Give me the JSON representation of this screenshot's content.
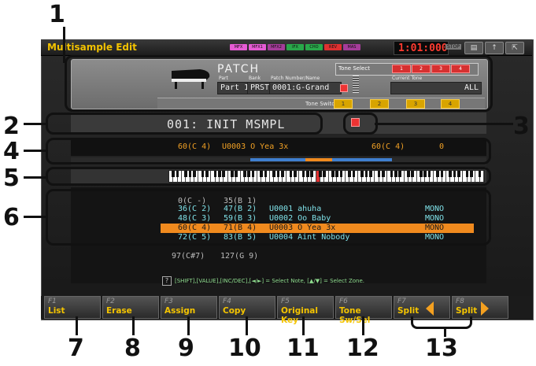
{
  "window": {
    "title": "Multisample Edit",
    "indicators": [
      "MFX",
      "MFX1",
      "MFX2",
      "IFX",
      "CHO",
      "REV",
      "MAS"
    ],
    "indicator_colors": [
      "#e65bd4",
      "#e65bd4",
      "#a53c9a",
      "#29a84a",
      "#29a84a",
      "#e03030",
      "#a53c9a"
    ],
    "clock": "1:01:000",
    "stop_label": "STOP"
  },
  "patch": {
    "header": "PATCH",
    "tone_select_label": "Tone Select",
    "tone_buttons": [
      "1",
      "2",
      "3",
      "4"
    ],
    "part_label": "Part",
    "part_value": "Part 1",
    "bank_label": "Bank",
    "bank_value": "PRST",
    "patch_number_label": "Patch Number/Name",
    "patch_number_value": "0001:G-Grand",
    "current_tone_label": "Current Tone",
    "current_tone_value": "ALL",
    "tone_switch_label": "Tone Switch",
    "tone_switches": [
      "1",
      "2",
      "3",
      "4"
    ]
  },
  "multisample": {
    "name": "001: INIT MSMPL"
  },
  "zone_info": {
    "low_key": "60(C 4)",
    "sample": "U0003 O Yea 3x",
    "high_key": "60(C 4)",
    "value": "0"
  },
  "zone_list": {
    "top_row": {
      "low": "0(C -)",
      "high": "35(B 1)"
    },
    "rows": [
      {
        "low": "36(C 2)",
        "high": "47(B 2)",
        "sample": "U0001 ahuha",
        "mode": "MONO",
        "selected": false
      },
      {
        "low": "48(C 3)",
        "high": "59(B 3)",
        "sample": "U0002 Oo Baby",
        "mode": "MONO",
        "selected": false
      },
      {
        "low": "60(C 4)",
        "high": "71(B 4)",
        "sample": "U0003 O Yea 3x",
        "mode": "MONO",
        "selected": true
      },
      {
        "low": "72(C 5)",
        "high": "83(B 5)",
        "sample": "U0004 Aint Nobody",
        "mode": "MONO",
        "selected": false
      }
    ],
    "bottom_row": {
      "low": "97(C#7)",
      "high": "127(G 9)"
    }
  },
  "help": {
    "text": "[SHIFT],[VALUE],[INC/DEC],[◄/►] = Select Note, [▲/▼] = Select Zone."
  },
  "function_keys": [
    {
      "key": "F1",
      "label": "List"
    },
    {
      "key": "F2",
      "label": "Erase"
    },
    {
      "key": "F3",
      "label": "Assign"
    },
    {
      "key": "F4",
      "label": "Copy"
    },
    {
      "key": "F5",
      "label": "Original Key"
    },
    {
      "key": "F6",
      "label": "Tone Sw/Sel"
    },
    {
      "key": "F7",
      "label": "Split"
    },
    {
      "key": "F8",
      "label": "Split"
    }
  ],
  "callouts": [
    "1",
    "2",
    "3",
    "4",
    "5",
    "6",
    "7",
    "8",
    "9",
    "10",
    "11",
    "12",
    "13"
  ],
  "colors": {
    "title": "#f2c200",
    "zone_text": "#f0a024",
    "list_text": "#7fe1e8",
    "selected_row": "#f08a1e",
    "tone_button": "#d63030",
    "tone_switch": "#d8a400"
  }
}
